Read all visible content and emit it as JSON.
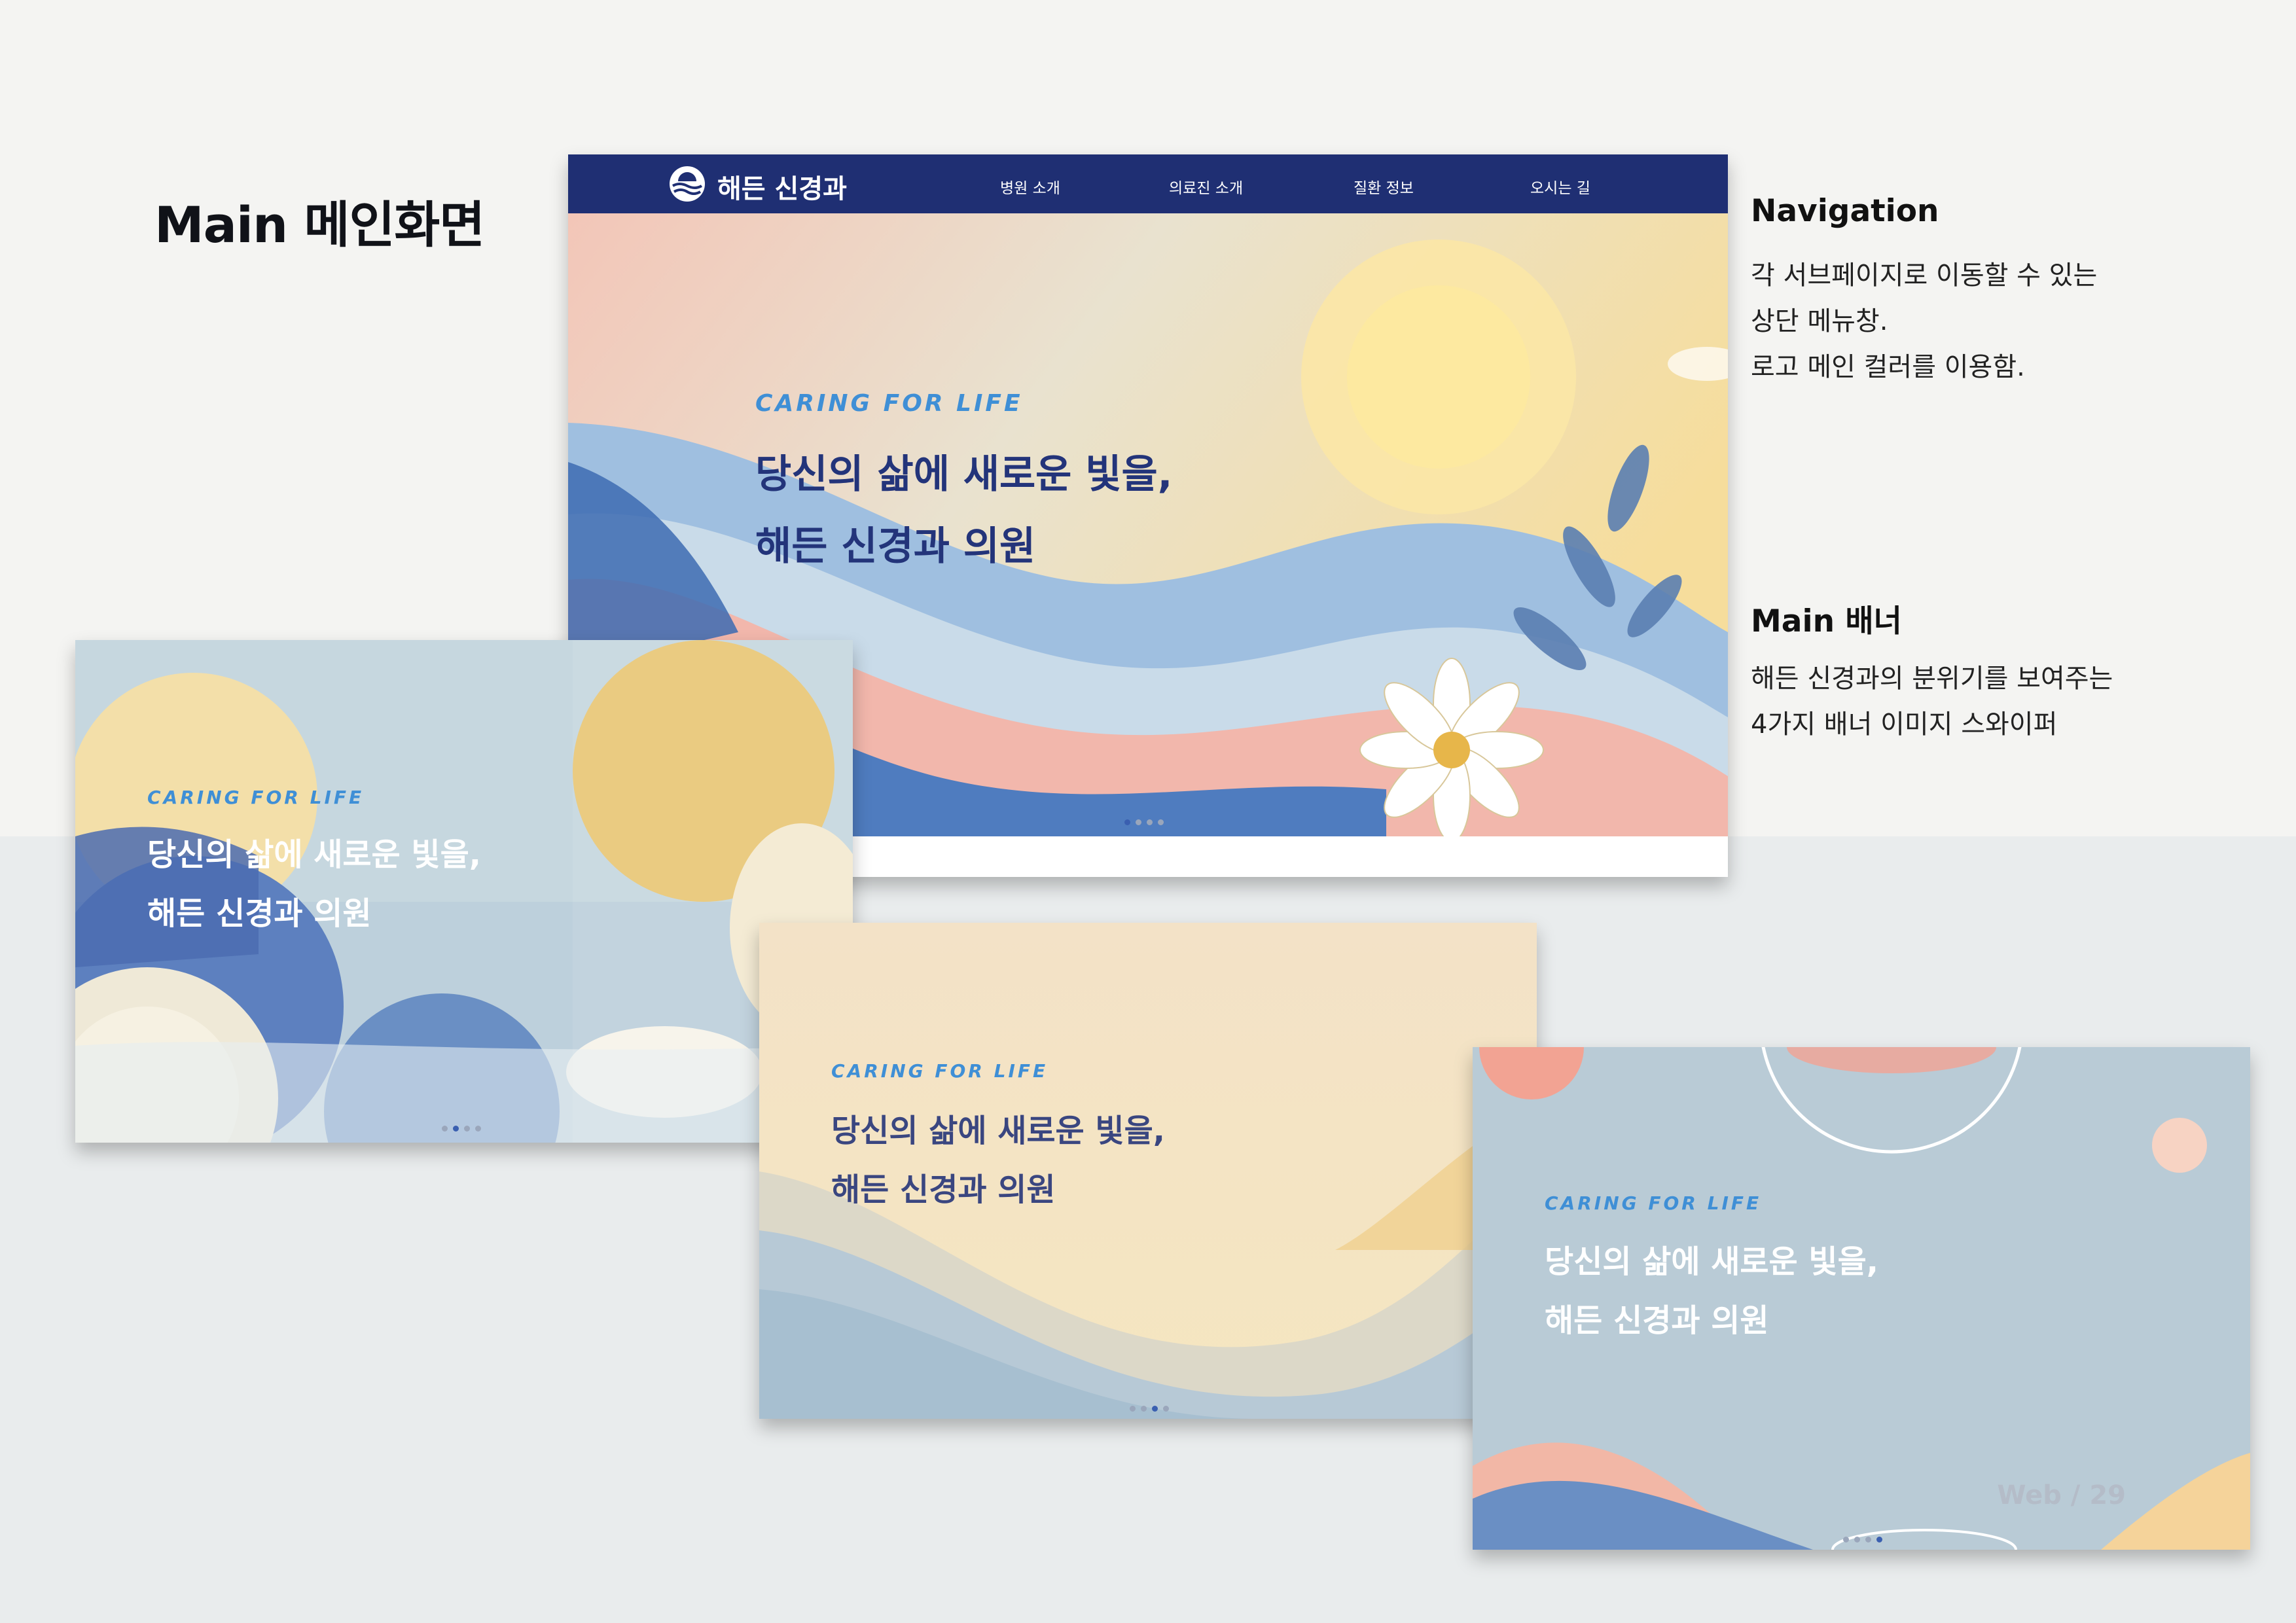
{
  "page": {
    "title": "Main 메인화면"
  },
  "notes": [
    {
      "title": "Navigation",
      "lines": [
        "각 서브페이지로 이동할 수 있는",
        "상단 메뉴창.",
        "로고 메인 컬러를 이용함."
      ]
    },
    {
      "title": "Main 배너",
      "lines": [
        "해든 신경과의 분위기를 보여주는",
        "4가지 배너 이미지 스와이퍼"
      ]
    }
  ],
  "colors": {
    "nav": "#1f2f73",
    "accent": "#3f8fd6",
    "headline": "#23347a"
  },
  "nav": {
    "logo_icon": "sun-wave-logo-icon",
    "logo_text": "해든 신경과",
    "items": [
      "병원 소개",
      "의료진 소개",
      "질환 정보",
      "오시는 길"
    ]
  },
  "banners": [
    {
      "tagline": "CARING FOR LIFE",
      "line1": "당신의 삶에 새로운 빛을,",
      "line2": "해든 신경과 의원",
      "active_dot": 1
    },
    {
      "tagline": "CARING FOR LIFE",
      "line1": "당신의 삶에 새로운 빛을,",
      "line2": "해든 신경과 의원",
      "active_dot": 2
    },
    {
      "tagline": "CARING FOR LIFE",
      "line1": "당신의 삶에 새로운 빛을,",
      "line2": "해든 신경과 의원",
      "active_dot": 3
    },
    {
      "tagline": "CARING FOR LIFE",
      "line1": "당신의 삶에 새로운 빛을,",
      "line2": "해든 신경과 의원",
      "active_dot": 4
    }
  ],
  "page_number": "Web / 29"
}
